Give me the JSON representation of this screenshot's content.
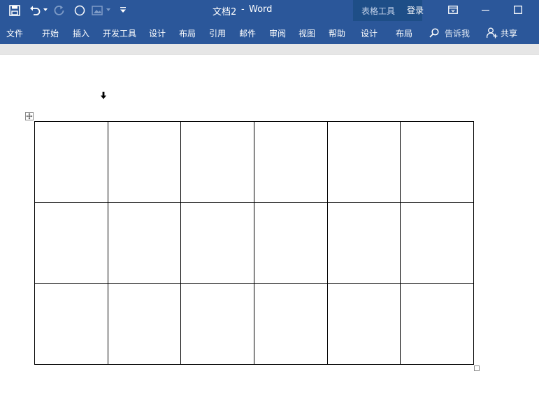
{
  "titlebar": {
    "document_title": "文档2",
    "separator": "-",
    "app_name": "Word",
    "contextual_tools": "表格工具",
    "sign_in": "登录"
  },
  "ribbon": {
    "tabs": [
      "文件",
      "开始",
      "插入",
      "开发工具",
      "设计",
      "布局",
      "引用",
      "邮件",
      "审阅",
      "视图",
      "帮助"
    ],
    "contextual_tabs": [
      "设计",
      "布局"
    ],
    "tell_me": "告诉我",
    "share": "共享"
  },
  "table": {
    "rows": 3,
    "columns": 6
  },
  "colors": {
    "title_bar": "#2b579a",
    "contextual_group": "#1e4e87",
    "ribbon_bottom": "#e6e6e6",
    "page": "#ffffff"
  }
}
